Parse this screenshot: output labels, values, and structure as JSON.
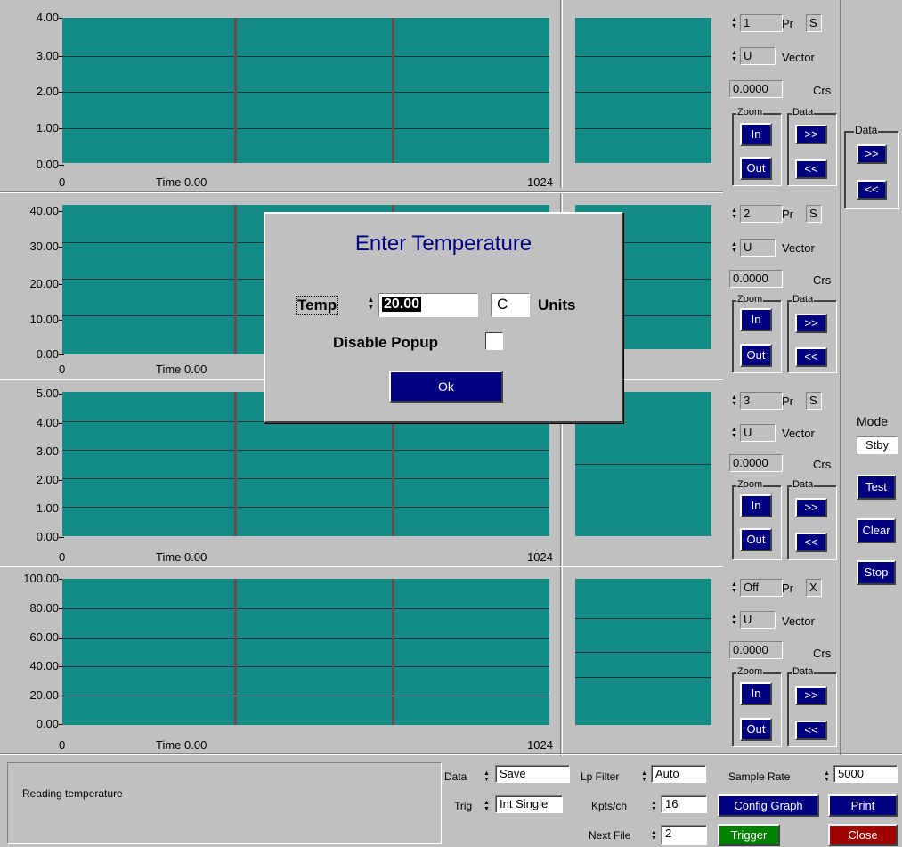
{
  "panels": [
    {
      "yticks": [
        "4.00",
        "3.00",
        "2.00",
        "1.00",
        "0.00"
      ],
      "x_start": "0",
      "time": "Time 0.00",
      "x_end": "1024",
      "channel": "1",
      "pr": "Pr",
      "s": "S",
      "unit": "U",
      "vector": "Vector",
      "crs_value": "0.0000",
      "crs": "Crs"
    },
    {
      "yticks": [
        "40.00",
        "30.00",
        "20.00",
        "10.00",
        "0.00"
      ],
      "x_start": "0",
      "time": "Time 0.00",
      "x_end": "",
      "channel": "2",
      "pr": "Pr",
      "s": "S",
      "unit": "U",
      "vector": "Vector",
      "crs_value": "0.0000",
      "crs": "Crs"
    },
    {
      "yticks": [
        "5.00",
        "4.00",
        "3.00",
        "2.00",
        "1.00",
        "0.00"
      ],
      "x_start": "0",
      "time": "Time 0.00",
      "x_end": "1024",
      "channel": "3",
      "pr": "Pr",
      "s": "S",
      "unit": "U",
      "vector": "Vector",
      "crs_value": "0.0000",
      "crs": "Crs"
    },
    {
      "yticks": [
        "100.00",
        "80.00",
        "60.00",
        "40.00",
        "20.00",
        "0.00"
      ],
      "x_start": "0",
      "time": "Time 0.00",
      "x_end": "1024",
      "channel": "Off",
      "pr": "Pr",
      "s": "X",
      "unit": "U",
      "vector": "Vector",
      "crs_value": "0.0000",
      "crs": "Crs"
    }
  ],
  "group_labels": {
    "zoom": "Zoom",
    "data": "Data"
  },
  "buttons": {
    "in": "In",
    "out": "Out",
    "next": ">>",
    "prev": "<<"
  },
  "right": {
    "data_title": "Data",
    "mode_label": "Mode",
    "mode_value": "Stby",
    "test": "Test",
    "clear": "Clear",
    "stop": "Stop"
  },
  "status": {
    "message": "Reading temperature"
  },
  "bottom": {
    "data_label": "Data",
    "data_value": "Save",
    "trig_label": "Trig",
    "trig_value": "Int Single",
    "lp_label": "Lp Filter",
    "lp_value": "Auto",
    "kpts_label": "Kpts/ch",
    "kpts_value": "16",
    "nextfile_label": "Next File",
    "nextfile_value": "2",
    "sample_label": "Sample Rate",
    "sample_value": "5000",
    "config_graph": "Config Graph",
    "print": "Print",
    "trigger": "Trigger",
    "close": "Close"
  },
  "dialog": {
    "title": "Enter Temperature",
    "temp_label": "Temp",
    "temp_value": "20.00",
    "unit_value": "C",
    "units_label": "Units",
    "disable_label": "Disable Popup",
    "ok": "Ok"
  },
  "colors": {
    "plot": "#158b87",
    "navy": "#000080",
    "trigger": "#008000",
    "close": "#a00000"
  }
}
